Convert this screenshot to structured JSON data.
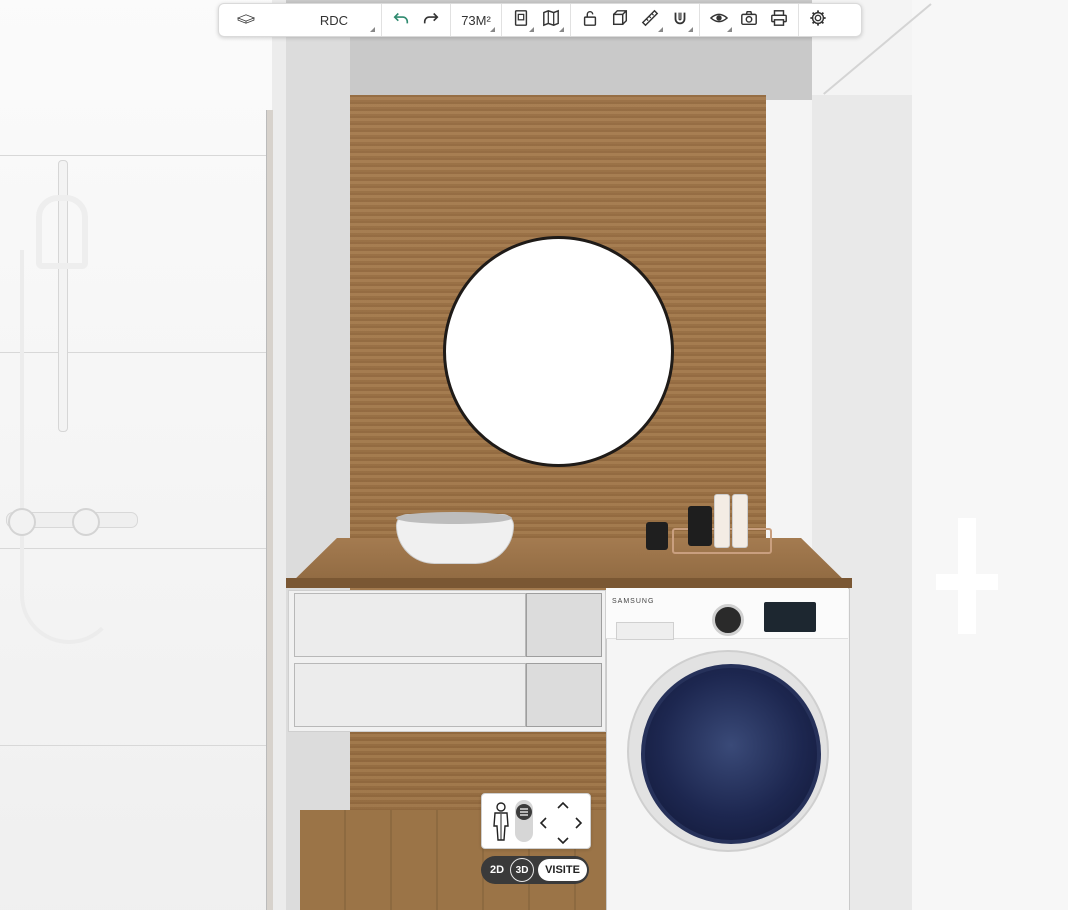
{
  "toolbar": {
    "floor_select": {
      "value": "RDC",
      "icon": "floor-plan-icon"
    },
    "history": {
      "undo_icon": "undo-icon",
      "redo_icon": "redo-icon"
    },
    "area": {
      "value": "73M²"
    },
    "plan_tools": [
      {
        "icon": "document-icon"
      },
      {
        "icon": "map-icon"
      }
    ],
    "edit_tools": [
      {
        "icon": "lock-icon"
      },
      {
        "icon": "cube-icon"
      },
      {
        "icon": "ruler-icon"
      },
      {
        "icon": "magnet-icon"
      }
    ],
    "view_tools": [
      {
        "icon": "eye-icon"
      },
      {
        "icon": "camera-icon"
      },
      {
        "icon": "print-icon"
      }
    ],
    "settings": {
      "icon": "gear-icon"
    },
    "colors": {
      "background": "#ffffff",
      "icon": "#333333",
      "undo_accent": "#2f8a6f"
    }
  },
  "scene": {
    "washer_brand": "SAMSUNG"
  },
  "navigation": {
    "person_icon": "person-icon",
    "height_slider_icon": "menu-lines-icon",
    "arrows": {
      "up": "^",
      "down": "v",
      "left": "<",
      "right": ">"
    },
    "modes": {
      "two_d": "2D",
      "three_d": "3D",
      "visite": "VISITE"
    },
    "active_mode": "VISITE",
    "colors": {
      "bar": "#3a3a3a",
      "active": "#ffffff"
    }
  }
}
